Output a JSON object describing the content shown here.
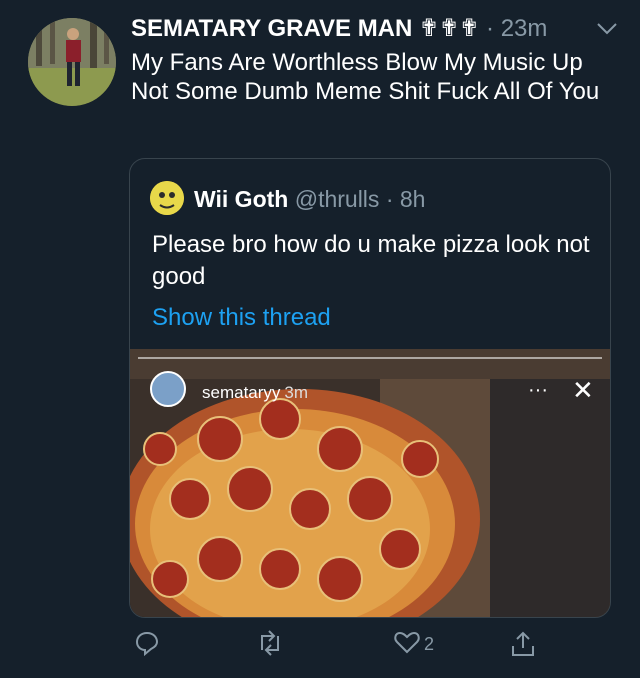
{
  "tweet": {
    "display_name": "SEMATARY GRAVE MAN",
    "name_emoji": "✟✟✟",
    "separator": "·",
    "time": "23m",
    "text": "My Fans Are Worthless Blow My Music Up Not Some Dumb Meme Shit Fuck All Of You"
  },
  "quote": {
    "display_name": "Wii Goth",
    "handle": "@thrulls",
    "separator": "·",
    "time": "8h",
    "text": "Please bro how do u make pizza look not good",
    "link": "Show this thread",
    "story": {
      "username": "semataryy",
      "time": "3m",
      "more": "···",
      "close": "✕"
    }
  },
  "actions": {
    "likes": "2"
  },
  "icons": {
    "reply": "reply-icon",
    "retweet": "retweet-icon",
    "like": "heart-icon",
    "share": "share-icon",
    "chevron": "chevron-down-icon"
  },
  "colors": {
    "background": "#15202b",
    "muted": "#8899a6",
    "link": "#1da1f2",
    "border": "#38444d"
  }
}
